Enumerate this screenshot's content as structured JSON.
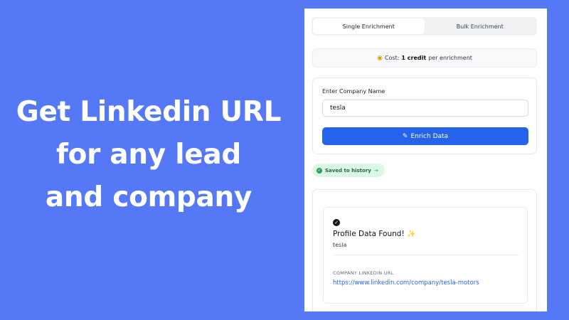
{
  "headline": {
    "lines": [
      "Get Linkedin URL",
      "for any lead",
      "and company"
    ]
  },
  "tabs": [
    {
      "label": "Single Enrichment",
      "active": true
    },
    {
      "label": "Bulk Enrichment",
      "active": false
    }
  ],
  "cost": {
    "icon": "coins-icon",
    "prefix": "Cost:",
    "amount": "1 credit",
    "suffix": "per enrichment"
  },
  "form": {
    "label": "Enter Company Name",
    "input_value": "tesla",
    "button_label": "Enrich Data",
    "button_icon": "pencil-icon"
  },
  "saved": {
    "label": "Saved to history",
    "arrow": "→"
  },
  "result": {
    "title": "Profile Data Found!",
    "subtitle": "tesla",
    "url_label": "COMPANY LINKEDIN URL",
    "url": "https://www.linkedin.com/company/tesla-motors"
  },
  "colors": {
    "background": "#5478f6",
    "accent": "#2563eb",
    "success_bg": "#dcf7e5"
  }
}
